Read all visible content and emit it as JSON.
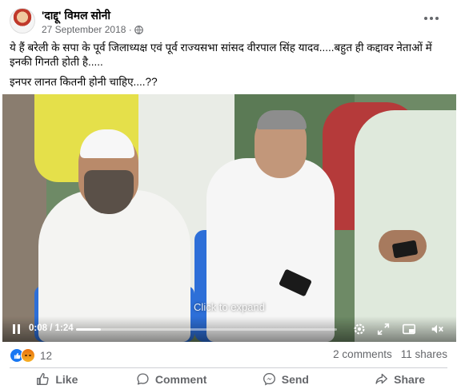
{
  "post": {
    "author": "'दाद्दू' विमल सोनी",
    "date": "27 September 2018 ·",
    "text_line1": "ये हैं बरेली के सपा के पूर्व जिलाध्यक्ष एवं पूर्व राज्यसभा सांसद वीरपाल सिंह यादव.....बहुत ही कद्दावर नेताओं में इनकी गिनती होती है.....",
    "text_line2": "इनपर लानत कितनी होनी चाहिए....??"
  },
  "video": {
    "overlay_text": "Click to expand",
    "current_time": "0:08",
    "duration": "1:24",
    "time_display": "0:08 / 1:24",
    "progress_fraction": 0.095,
    "icons": [
      "pause-icon",
      "settings-icon",
      "fullscreen-icon",
      "pip-icon",
      "mute-icon"
    ]
  },
  "stats": {
    "reaction_count": "12",
    "comments": "2 comments",
    "shares": "11 shares"
  },
  "actions": {
    "like": "Like",
    "comment": "Comment",
    "send": "Send",
    "share": "Share"
  },
  "colors": {
    "like_blue": "#1877f2",
    "secondary_text": "#65676b"
  }
}
